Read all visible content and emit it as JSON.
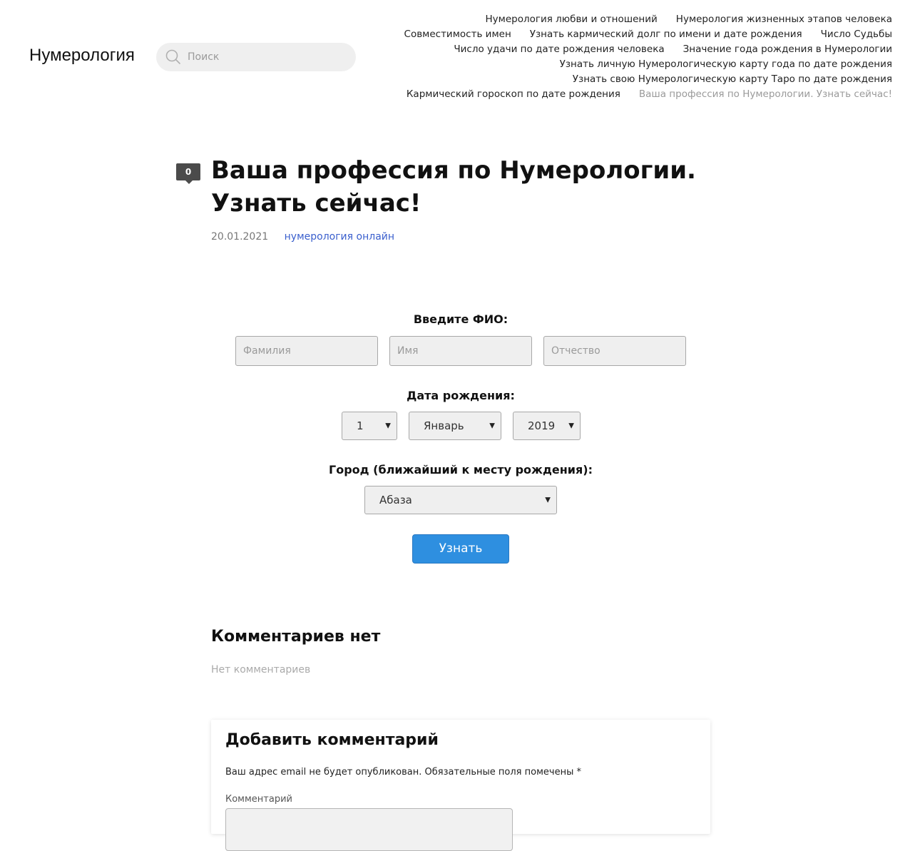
{
  "header": {
    "site_title": "Нумерология",
    "search": {
      "placeholder": "Поиск"
    }
  },
  "nav": {
    "rows": [
      [
        "Нумерология любви и отношений",
        "Нумерология жизненных этапов человека"
      ],
      [
        "Совместимость имен",
        "Узнать кармический долг по имени и дате рождения",
        "Число Судьбы"
      ],
      [
        "Число удачи по дате рождения человека",
        "Значение года рождения в Нумерологии"
      ],
      [
        "Узнать личную Нумерологическую карту года по дате рождения"
      ],
      [
        "Узнать свою Нумерологическую карту Таро по дате рождения"
      ],
      [
        "Кармический гороскоп по дате рождения",
        "Ваша профессия по Нумерологии. Узнать сейчас!"
      ]
    ],
    "current": "Ваша профессия по Нумерологии. Узнать сейчас!"
  },
  "post": {
    "comment_count": "0",
    "title": "Ваша профессия по Нумерологии. Узнать сейчас!",
    "date": "20.01.2021",
    "category": "нумерология онлайн"
  },
  "form": {
    "fio_label": "Введите ФИО:",
    "surname_placeholder": "Фамилия",
    "name_placeholder": "Имя",
    "patronymic_placeholder": "Отчество",
    "birth_label": "Дата рождения:",
    "day": "1",
    "month": "Январь",
    "year": "2019",
    "city_label": "Город (ближайший к месту рождения):",
    "city": "Абаза",
    "submit_label": "Узнать"
  },
  "comments": {
    "title": "Комментариев нет",
    "empty_text": "Нет комментариев"
  },
  "reply": {
    "title": "Добавить комментарий",
    "notes": "Ваш адрес email не будет опубликован. Обязательные поля помечены *",
    "comment_label": "Комментарий"
  },
  "icons": {
    "search": "search-icon",
    "caret": "caret-down-icon"
  },
  "colors": {
    "accent_button": "#2e8fe0",
    "category_link": "#3a5fcd",
    "current_nav": "#9a9a9a",
    "badge": "#4b4b4b"
  }
}
